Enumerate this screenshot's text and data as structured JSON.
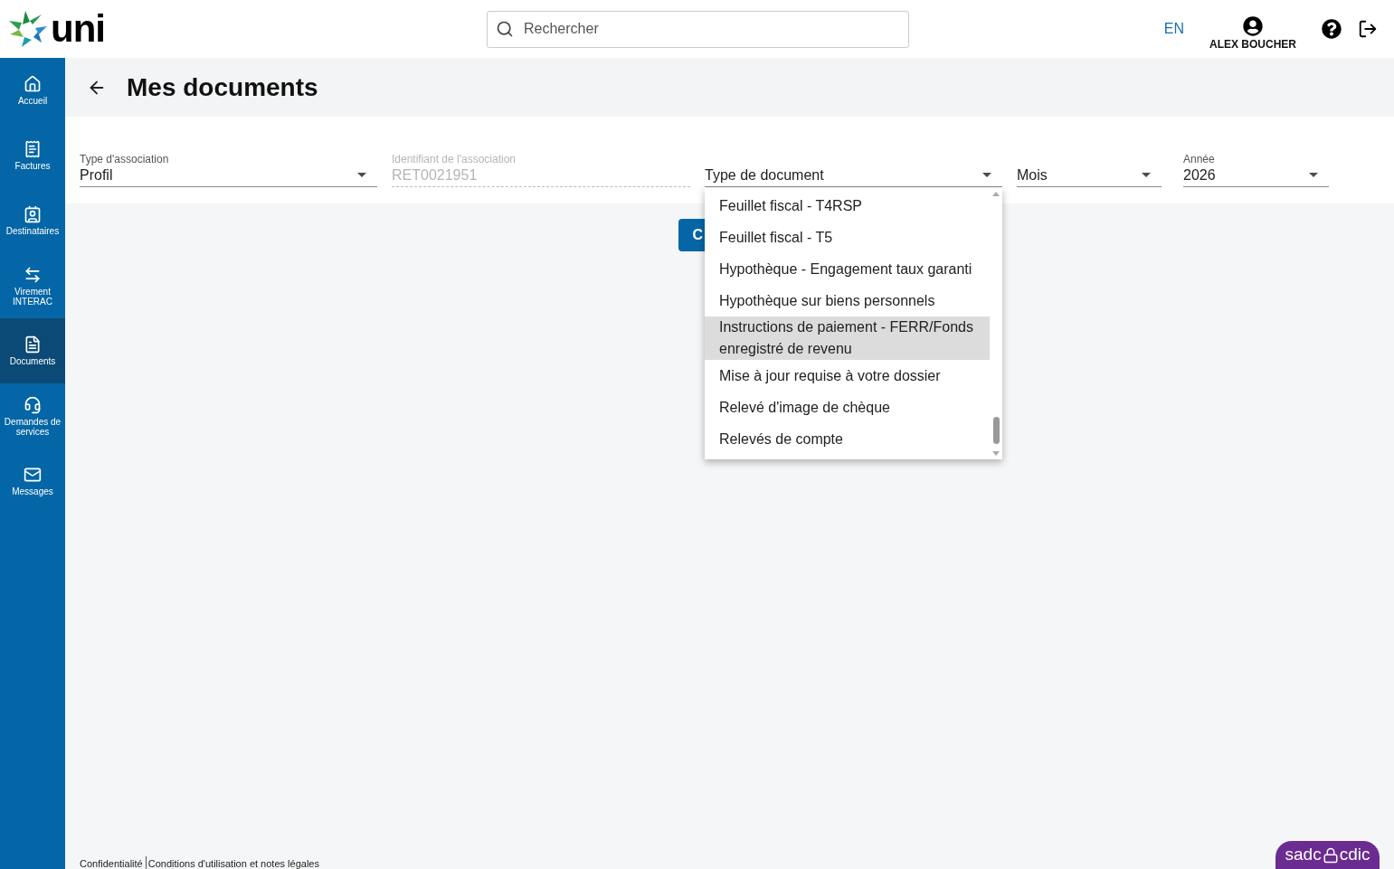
{
  "logo": {
    "text": "uni"
  },
  "search": {
    "placeholder": "Rechercher"
  },
  "header": {
    "language": "EN",
    "user": "ALEX BOUCHER"
  },
  "sidebar": {
    "items": [
      {
        "label": "Accueil",
        "selected": false
      },
      {
        "label": "Factures",
        "selected": false
      },
      {
        "label": "Destinataires",
        "selected": false
      },
      {
        "label": "Virement INTERAC",
        "selected": false
      },
      {
        "label": "Documents",
        "selected": true
      },
      {
        "label": "Demandes de services",
        "selected": false
      },
      {
        "label": "Messages",
        "selected": false
      }
    ]
  },
  "page": {
    "title": "Mes documents"
  },
  "filters": [
    {
      "label": "Type d'association",
      "value": "Profil",
      "kind": "select",
      "disabled": false
    },
    {
      "label": "Identifiant de l'association",
      "value": "RET0021951",
      "kind": "text",
      "disabled": true
    },
    {
      "value": "Type de document",
      "kind": "select",
      "disabled": false
    },
    {
      "value": "Mois",
      "kind": "select",
      "disabled": false
    },
    {
      "label": "Année",
      "value": "2026",
      "kind": "select",
      "disabled": false
    }
  ],
  "button": {
    "label": "C"
  },
  "dropdown": {
    "options": [
      {
        "label": "Feuillet fiscal - T4RSP",
        "selected": false
      },
      {
        "label": "Feuillet fiscal - T5",
        "selected": false
      },
      {
        "label": "Hypothèque - Engagement taux garanti",
        "selected": false
      },
      {
        "label": "Hypothèque sur biens personnels",
        "selected": false
      },
      {
        "label": "Instructions de paiement - FERR/Fonds enregistré de revenu",
        "selected": true
      },
      {
        "label": "Mise à jour requise à votre dossier",
        "selected": false
      },
      {
        "label": "Relevé d'image de chèque",
        "selected": false
      },
      {
        "label": "Relevés de compte",
        "selected": false
      }
    ]
  },
  "footer": {
    "links": [
      "Confidentialité",
      "Conditions d'utilisation et notes légales"
    ]
  },
  "badge": {
    "left": "sadc",
    "right": "cdic"
  }
}
